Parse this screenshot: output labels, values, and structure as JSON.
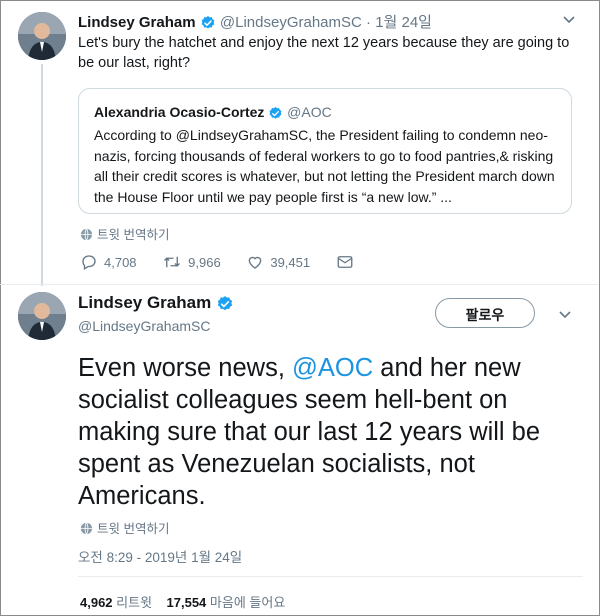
{
  "reply_tweet": {
    "name": "Lindsey Graham",
    "handle": "@LindseyGrahamSC",
    "separator": "·",
    "date": "1월 24일",
    "text": "Let's bury the hatchet and enjoy the next 12 years because they are going to be our last, right?",
    "quoted": {
      "name": "Alexandria Ocasio-Cortez",
      "handle": "@AOC",
      "text": "According to @LindseyGrahamSC, the President failing to condemn neo-nazis, forcing thousands of federal workers to go to food pantries,& risking all their credit scores is whatever, but not letting the President march down the House Floor until we pay people first is “a new low.” ..."
    },
    "translate_label": "트윗 번역하기",
    "replies": "4,708",
    "retweets": "9,966",
    "likes": "39,451"
  },
  "main_tweet": {
    "name": "Lindsey Graham",
    "handle": "@LindseyGrahamSC",
    "follow_label": "팔로우",
    "text_before": "Even worse news, ",
    "mention": "@AOC",
    "text_after": " and her new socialist colleagues seem hell-bent on making sure that our last 12 years will be spent as Venezuelan socialists, not Americans.",
    "translate_label": "트윗 번역하기",
    "timestamp": "오전 8:29 - 2019년 1월 24일",
    "retweet_count": "4,962",
    "retweet_label": "리트윗",
    "like_count": "17,554",
    "like_label": "마음에 들어요"
  },
  "colors": {
    "accent": "#1b95e0",
    "muted": "#657786",
    "verified": "#1da1f2"
  }
}
